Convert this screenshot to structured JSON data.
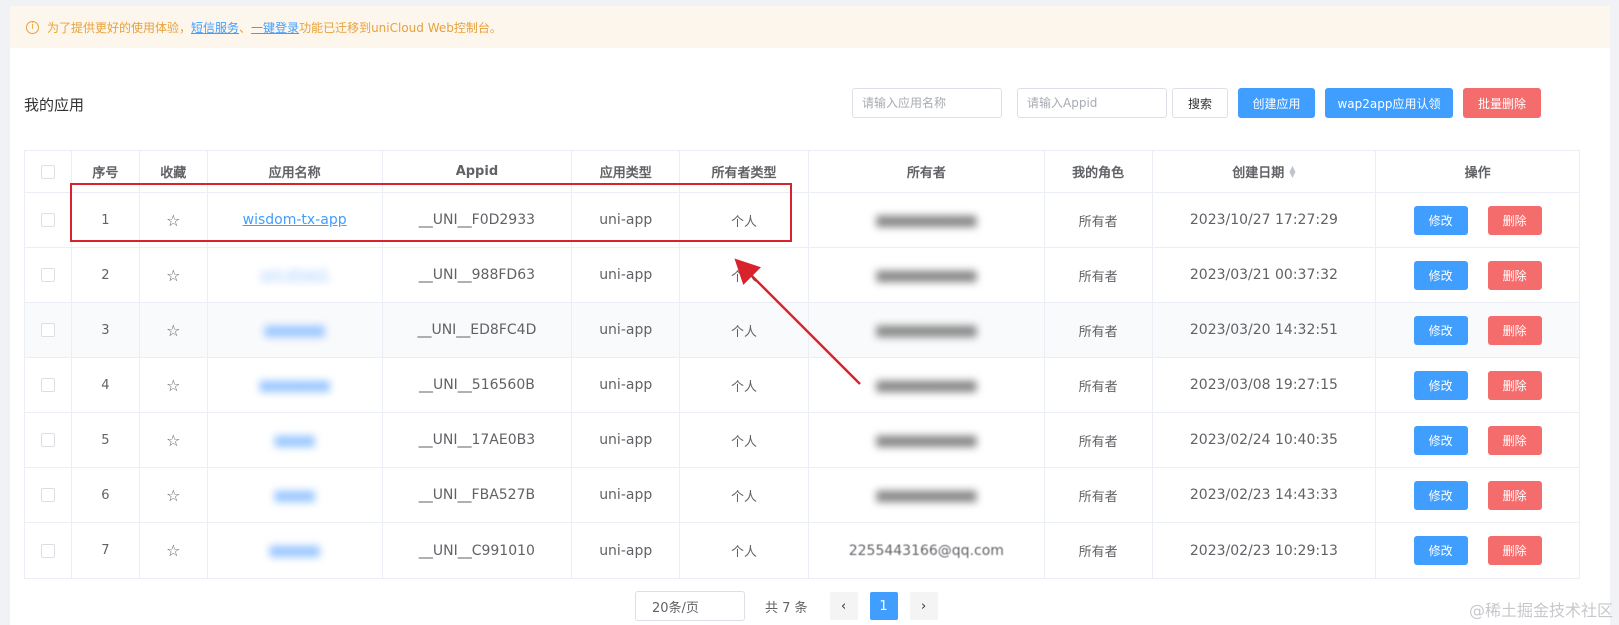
{
  "notice": {
    "icon": "info-icon",
    "prefix": "为了提供更好的使用体验，",
    "link1": "短信服务",
    "sep": "、",
    "link2": "一键登录",
    "suffix": "功能已迁移到uniCloud Web控制台。"
  },
  "page": {
    "title": "我的应用"
  },
  "toolbar": {
    "name_placeholder": "请输入应用名称",
    "appid_placeholder": "请输入Appid",
    "search_label": "搜索",
    "create_label": "创建应用",
    "wap2app_label": "wap2app应用认领",
    "batch_delete_label": "批量删除"
  },
  "table": {
    "headers": {
      "index": "序号",
      "favorite": "收藏",
      "app_name": "应用名称",
      "appid": "Appid",
      "app_type": "应用类型",
      "owner_type": "所有者类型",
      "owner": "所有者",
      "my_role": "我的角色",
      "created": "创建日期",
      "actions": "操作"
    },
    "edit_label": "修改",
    "delete_label": "删除",
    "rows": [
      {
        "index": "1",
        "app_name": "wisdom-tx-app",
        "appid": "__UNI__F0D2933",
        "app_type": "uni-app",
        "owner_type": "个人",
        "owner": "",
        "role": "所有者",
        "created": "2023/10/27 17:27:29"
      },
      {
        "index": "2",
        "app_name": "uni-shop1",
        "appid": "__UNI__988FD63",
        "app_type": "uni-app",
        "owner_type": "个人",
        "owner": "",
        "role": "所有者",
        "created": "2023/03/21 00:37:32"
      },
      {
        "index": "3",
        "app_name": "",
        "appid": "__UNI__ED8FC4D",
        "app_type": "uni-app",
        "owner_type": "个人",
        "owner": "",
        "role": "所有者",
        "created": "2023/03/20 14:32:51"
      },
      {
        "index": "4",
        "app_name": "",
        "appid": "__UNI__516560B",
        "app_type": "uni-app",
        "owner_type": "个人",
        "owner": "",
        "role": "所有者",
        "created": "2023/03/08 19:27:15"
      },
      {
        "index": "5",
        "app_name": "",
        "appid": "__UNI__17AE0B3",
        "app_type": "uni-app",
        "owner_type": "个人",
        "owner": "",
        "role": "所有者",
        "created": "2023/02/24 10:40:35"
      },
      {
        "index": "6",
        "app_name": "",
        "appid": "__UNI__FBA527B",
        "app_type": "uni-app",
        "owner_type": "个人",
        "owner": "",
        "role": "所有者",
        "created": "2023/02/23 14:43:33"
      },
      {
        "index": "7",
        "app_name": "",
        "appid": "__UNI__C991010",
        "app_type": "uni-app",
        "owner_type": "个人",
        "owner": "2255443166@qq.com",
        "role": "所有者",
        "created": "2023/02/23 10:29:13"
      }
    ]
  },
  "pagination": {
    "page_size": "20条/页",
    "total": "共 7 条",
    "prev": "‹",
    "current": "1",
    "next": "›"
  },
  "watermark": "@稀土掘金技术社区",
  "colors": {
    "primary": "#409eff",
    "danger": "#f56c6c",
    "warning": "#e6a23c",
    "annotation": "#d9232c"
  }
}
